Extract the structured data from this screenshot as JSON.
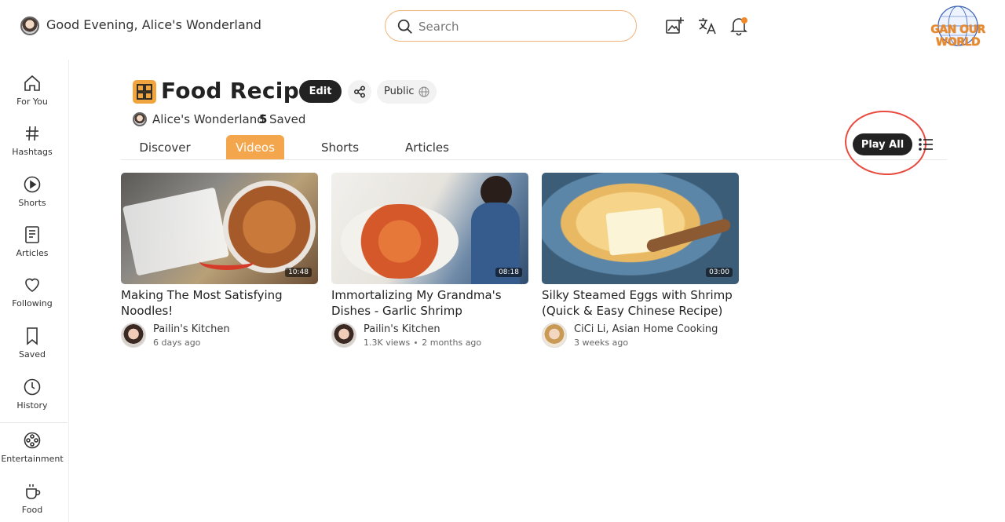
{
  "header": {
    "greeting": "Good Evening, Alice's Wonderland",
    "search_placeholder": "Search",
    "icons": [
      "upload-icon",
      "translate-icon",
      "bell-icon"
    ],
    "logo_text": "GAN OUR WORLD"
  },
  "sidebar": {
    "items": [
      {
        "label": "For You",
        "icon": "home-icon"
      },
      {
        "label": "Hashtags",
        "icon": "hashtag-icon"
      },
      {
        "label": "Shorts",
        "icon": "shorts-icon"
      },
      {
        "label": "Articles",
        "icon": "articles-icon"
      },
      {
        "label": "Following",
        "icon": "heart-icon"
      },
      {
        "label": "Saved",
        "icon": "bookmark-icon"
      },
      {
        "label": "History",
        "icon": "clock-icon"
      },
      {
        "label": "Entertainment",
        "icon": "film-reel-icon"
      },
      {
        "label": "Food",
        "icon": "mug-icon"
      }
    ]
  },
  "playlist": {
    "title": "Food Recipes",
    "edit_label": "Edit",
    "visibility_label": "Public",
    "owner": "Alice's Wonderland",
    "saved_count": "5",
    "saved_label": "Saved",
    "play_all_label": "Play All"
  },
  "tabs": [
    {
      "label": "Discover",
      "active": false
    },
    {
      "label": "Videos",
      "active": true
    },
    {
      "label": "Shorts",
      "active": false
    },
    {
      "label": "Articles",
      "active": false
    }
  ],
  "videos": [
    {
      "title": "Making The Most Satisfying Noodles!",
      "duration": "10:48",
      "channel": "Pailin's Kitchen",
      "views": "",
      "age": "6 days ago"
    },
    {
      "title": "Immortalizing My Grandma's Dishes - Garlic Shrimp",
      "duration": "08:18",
      "channel": "Pailin's Kitchen",
      "views": "1.3K views",
      "age": "2 months ago"
    },
    {
      "title": "Silky Steamed Eggs with Shrimp (Quick & Easy Chinese Recipe) CiCi ...",
      "duration": "03:00",
      "channel": "CiCi Li, Asian Home Cooking",
      "views": "",
      "age": "3 weeks ago"
    }
  ],
  "colors": {
    "accent": "#f4a64d",
    "dark_button": "#222222",
    "highlight_ring": "#e84a3e"
  }
}
